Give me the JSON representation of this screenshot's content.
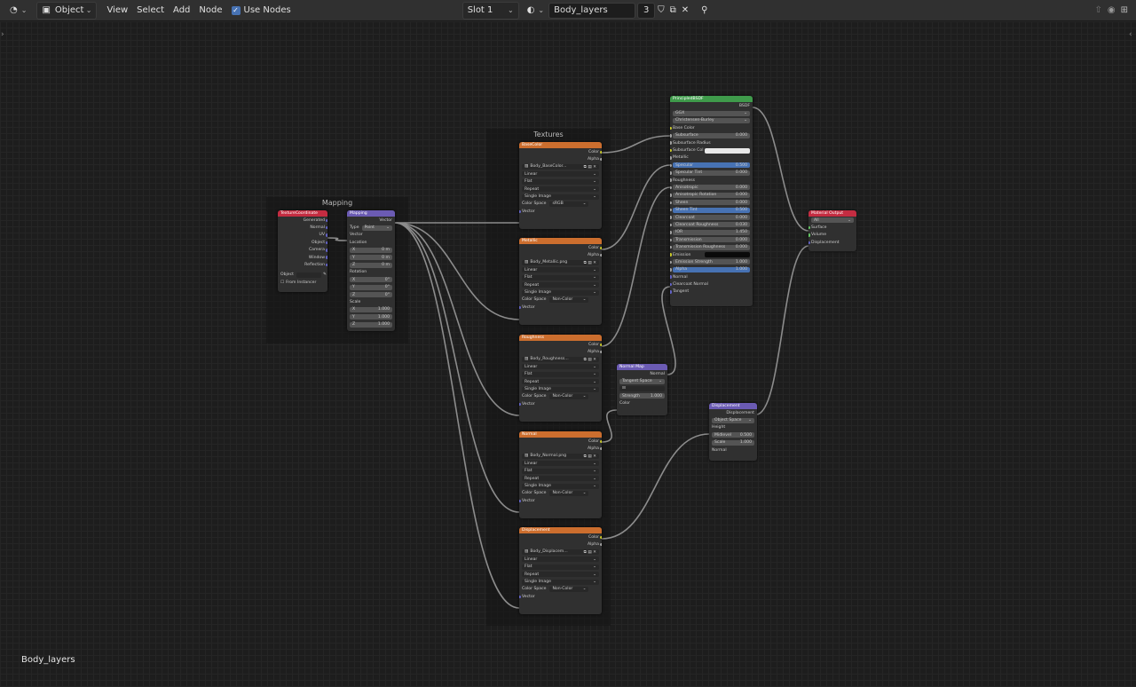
{
  "header": {
    "mode": "Object",
    "menu": [
      "View",
      "Select",
      "Add",
      "Node"
    ],
    "use_nodes_label": "Use Nodes",
    "slot": "Slot 1",
    "material_name": "Body_layers",
    "user_count": "3"
  },
  "frames": {
    "mapping": "Mapping",
    "textures": "Textures"
  },
  "nodes": {
    "texcoord": {
      "title": "TextureCoordinate",
      "outputs": [
        "Generated",
        "Normal",
        "UV",
        "Object",
        "Camera",
        "Window",
        "Reflection"
      ],
      "object_label": "Object",
      "from_instancer": "From Instancer"
    },
    "mapping": {
      "title": "Mapping",
      "out": "Vector",
      "type_label": "Type",
      "type_value": "Point",
      "vector": "Vector",
      "location": "Location",
      "rotation": "Rotation",
      "scale": "Scale",
      "loc": [
        [
          "X",
          "0 m"
        ],
        [
          "Y",
          "0 m"
        ],
        [
          "Z",
          "0 m"
        ]
      ],
      "rot": [
        [
          "X",
          "0°"
        ],
        [
          "Y",
          "0°"
        ],
        [
          "Z",
          "0°"
        ]
      ],
      "scl": [
        [
          "X",
          "1.000"
        ],
        [
          "Y",
          "1.000"
        ],
        [
          "Z",
          "1.000"
        ]
      ]
    },
    "textures": [
      {
        "title": "BaseColor",
        "image": "Body_BaseColor...",
        "colorspace": "sRGB"
      },
      {
        "title": "Metallic",
        "image": "Body_Metallic.png",
        "colorspace": "Non-Color"
      },
      {
        "title": "Roughness",
        "image": "Body_Roughness...",
        "colorspace": "Non-Color"
      },
      {
        "title": "Normal",
        "image": "Body_Normal.png",
        "colorspace": "Non-Color"
      },
      {
        "title": "Displacement",
        "image": "Body_Displacem...",
        "colorspace": "Non-Color"
      }
    ],
    "tex_common": {
      "color": "Color",
      "alpha": "Alpha",
      "interp": "Linear",
      "proj": "Flat",
      "ext": "Repeat",
      "src": "Single Image",
      "cs_label": "Color Space",
      "vector": "Vector"
    },
    "bsdf": {
      "title": "PrincipledBSDF",
      "out": "BSDF",
      "dist": "GGX",
      "sss": "Christensen-Burley",
      "rows": [
        {
          "t": "s",
          "l": "Base Color"
        },
        {
          "t": "v",
          "l": "Subsurface",
          "v": "0.000"
        },
        {
          "t": "s",
          "l": "Subsurface Radius"
        },
        {
          "t": "c",
          "l": "Subsurface Col"
        },
        {
          "t": "s",
          "l": "Metallic"
        },
        {
          "t": "b",
          "l": "Specular",
          "v": "0.500"
        },
        {
          "t": "v",
          "l": "Specular Tint",
          "v": "0.000"
        },
        {
          "t": "s",
          "l": "Roughness"
        },
        {
          "t": "v",
          "l": "Anisotropic",
          "v": "0.000"
        },
        {
          "t": "v",
          "l": "Anisotropic Rotation",
          "v": "0.000"
        },
        {
          "t": "v",
          "l": "Sheen",
          "v": "0.000"
        },
        {
          "t": "b",
          "l": "Sheen Tint",
          "v": "0.500"
        },
        {
          "t": "v",
          "l": "Clearcoat",
          "v": "0.000"
        },
        {
          "t": "v",
          "l": "Clearcoat Roughness",
          "v": "0.030"
        },
        {
          "t": "v",
          "l": "IOR",
          "v": "1.450"
        },
        {
          "t": "v",
          "l": "Transmission",
          "v": "0.000"
        },
        {
          "t": "v",
          "l": "Transmission Roughness",
          "v": "0.000"
        },
        {
          "t": "k",
          "l": "Emission"
        },
        {
          "t": "v",
          "l": "Emission Strength",
          "v": "1.000"
        },
        {
          "t": "b",
          "l": "Alpha",
          "v": "1.000"
        },
        {
          "t": "s",
          "l": "Normal"
        },
        {
          "t": "s",
          "l": "Clearcoat Normal"
        },
        {
          "t": "s",
          "l": "Tangent"
        }
      ]
    },
    "normalmap": {
      "title": "Normal Map",
      "out": "Normal",
      "space": "Tangent Space",
      "uv": "",
      "strength_label": "Strength",
      "strength": "1.000",
      "color": "Color"
    },
    "displacement": {
      "title": "Displacement",
      "out": "Displacement",
      "space": "Object Space",
      "height": "Height",
      "midlevel_label": "Midlevel",
      "midlevel": "0.500",
      "scale_label": "Scale",
      "scale": "1.000",
      "normal": "Normal"
    },
    "output": {
      "title": "Material Output",
      "target": "All",
      "inputs": [
        "Surface",
        "Volume",
        "Displacement"
      ]
    }
  },
  "footer_name": "Body_layers",
  "colors": {
    "tex_header": "#cc6e2e",
    "mapping_header": "#6b5bb3",
    "texcoord_header": "#c42c41",
    "bsdf_header": "#3f9b4b",
    "output_header": "#c42c41",
    "wire": "#8c8c8c"
  }
}
